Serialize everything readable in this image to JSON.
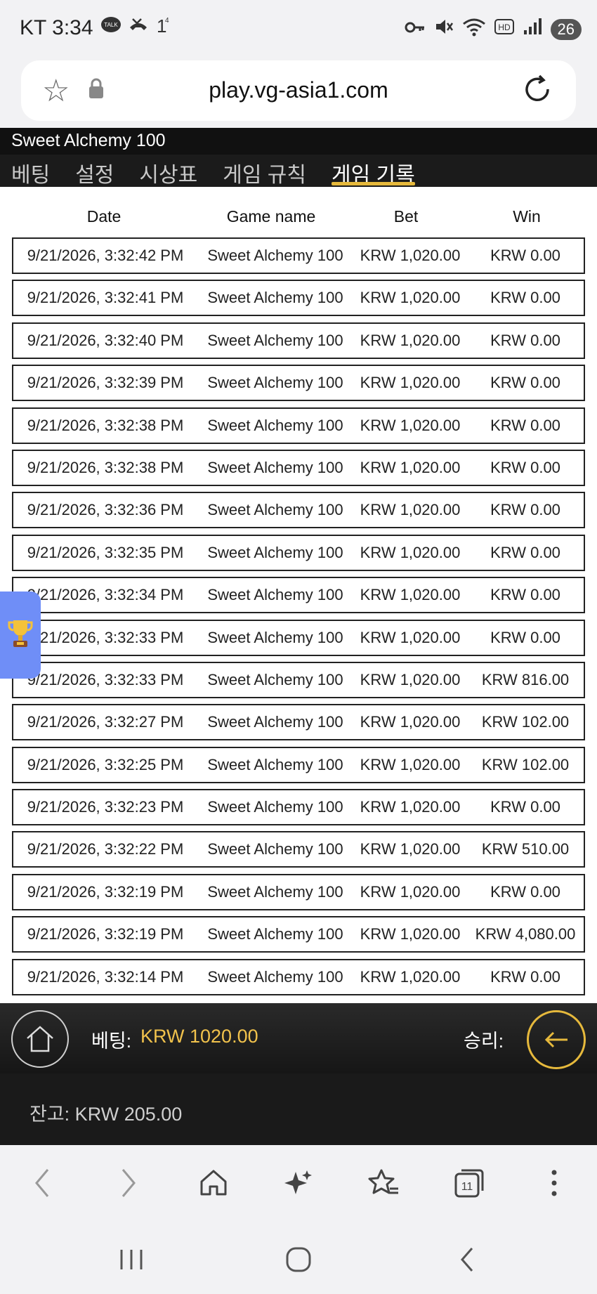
{
  "status_bar": {
    "carrier_time": "KT 3:34",
    "battery": "26",
    "icons": [
      "talk-icon",
      "missed-call-icon",
      "notification-count-icon",
      "key-icon",
      "mute-icon",
      "wifi-icon",
      "hd-icon",
      "signal-icon",
      "battery-icon"
    ]
  },
  "browser": {
    "url": "play.vg-asia1.com"
  },
  "game": {
    "title": "Sweet Alchemy 100",
    "tabs": [
      "베팅",
      "설정",
      "시상표",
      "게임 규칙",
      "게임 기록"
    ],
    "active_tab": 4
  },
  "history": {
    "columns": [
      "Date",
      "Game name",
      "Bet",
      "Win"
    ],
    "rows": [
      {
        "date": "9/21/2026, 3:32:42 PM",
        "game": "Sweet Alchemy 100",
        "bet": "KRW 1,020.00",
        "win": "KRW 0.00"
      },
      {
        "date": "9/21/2026, 3:32:41 PM",
        "game": "Sweet Alchemy 100",
        "bet": "KRW 1,020.00",
        "win": "KRW 0.00"
      },
      {
        "date": "9/21/2026, 3:32:40 PM",
        "game": "Sweet Alchemy 100",
        "bet": "KRW 1,020.00",
        "win": "KRW 0.00"
      },
      {
        "date": "9/21/2026, 3:32:39 PM",
        "game": "Sweet Alchemy 100",
        "bet": "KRW 1,020.00",
        "win": "KRW 0.00"
      },
      {
        "date": "9/21/2026, 3:32:38 PM",
        "game": "Sweet Alchemy 100",
        "bet": "KRW 1,020.00",
        "win": "KRW 0.00"
      },
      {
        "date": "9/21/2026, 3:32:38 PM",
        "game": "Sweet Alchemy 100",
        "bet": "KRW 1,020.00",
        "win": "KRW 0.00"
      },
      {
        "date": "9/21/2026, 3:32:36 PM",
        "game": "Sweet Alchemy 100",
        "bet": "KRW 1,020.00",
        "win": "KRW 0.00"
      },
      {
        "date": "9/21/2026, 3:32:35 PM",
        "game": "Sweet Alchemy 100",
        "bet": "KRW 1,020.00",
        "win": "KRW 0.00"
      },
      {
        "date": "9/21/2026, 3:32:34 PM",
        "game": "Sweet Alchemy 100",
        "bet": "KRW 1,020.00",
        "win": "KRW 0.00"
      },
      {
        "date": "9/21/2026, 3:32:33 PM",
        "game": "Sweet Alchemy 100",
        "bet": "KRW 1,020.00",
        "win": "KRW 0.00"
      },
      {
        "date": "9/21/2026, 3:32:33 PM",
        "game": "Sweet Alchemy 100",
        "bet": "KRW 1,020.00",
        "win": "KRW 816.00"
      },
      {
        "date": "9/21/2026, 3:32:27 PM",
        "game": "Sweet Alchemy 100",
        "bet": "KRW 1,020.00",
        "win": "KRW 102.00"
      },
      {
        "date": "9/21/2026, 3:32:25 PM",
        "game": "Sweet Alchemy 100",
        "bet": "KRW 1,020.00",
        "win": "KRW 102.00"
      },
      {
        "date": "9/21/2026, 3:32:23 PM",
        "game": "Sweet Alchemy 100",
        "bet": "KRW 1,020.00",
        "win": "KRW 0.00"
      },
      {
        "date": "9/21/2026, 3:32:22 PM",
        "game": "Sweet Alchemy 100",
        "bet": "KRW 1,020.00",
        "win": "KRW 510.00"
      },
      {
        "date": "9/21/2026, 3:32:19 PM",
        "game": "Sweet Alchemy 100",
        "bet": "KRW 1,020.00",
        "win": "KRW 0.00"
      },
      {
        "date": "9/21/2026, 3:32:19 PM",
        "game": "Sweet Alchemy 100",
        "bet": "KRW 1,020.00",
        "win": "KRW 4,080.00"
      },
      {
        "date": "9/21/2026, 3:32:14 PM",
        "game": "Sweet Alchemy 100",
        "bet": "KRW 1,020.00",
        "win": "KRW 0.00"
      }
    ]
  },
  "betbar": {
    "bet_label": "베팅:",
    "bet_value": "KRW 1020.00",
    "win_label": "승리:"
  },
  "balance": {
    "text": "잔고: KRW 205.00"
  },
  "browser_nav": {
    "tabs_count": "11"
  },
  "colors": {
    "accent_gold": "#e6b93c",
    "bet_value": "#f1c24c",
    "trophy_tab": "#6f8ef7"
  }
}
